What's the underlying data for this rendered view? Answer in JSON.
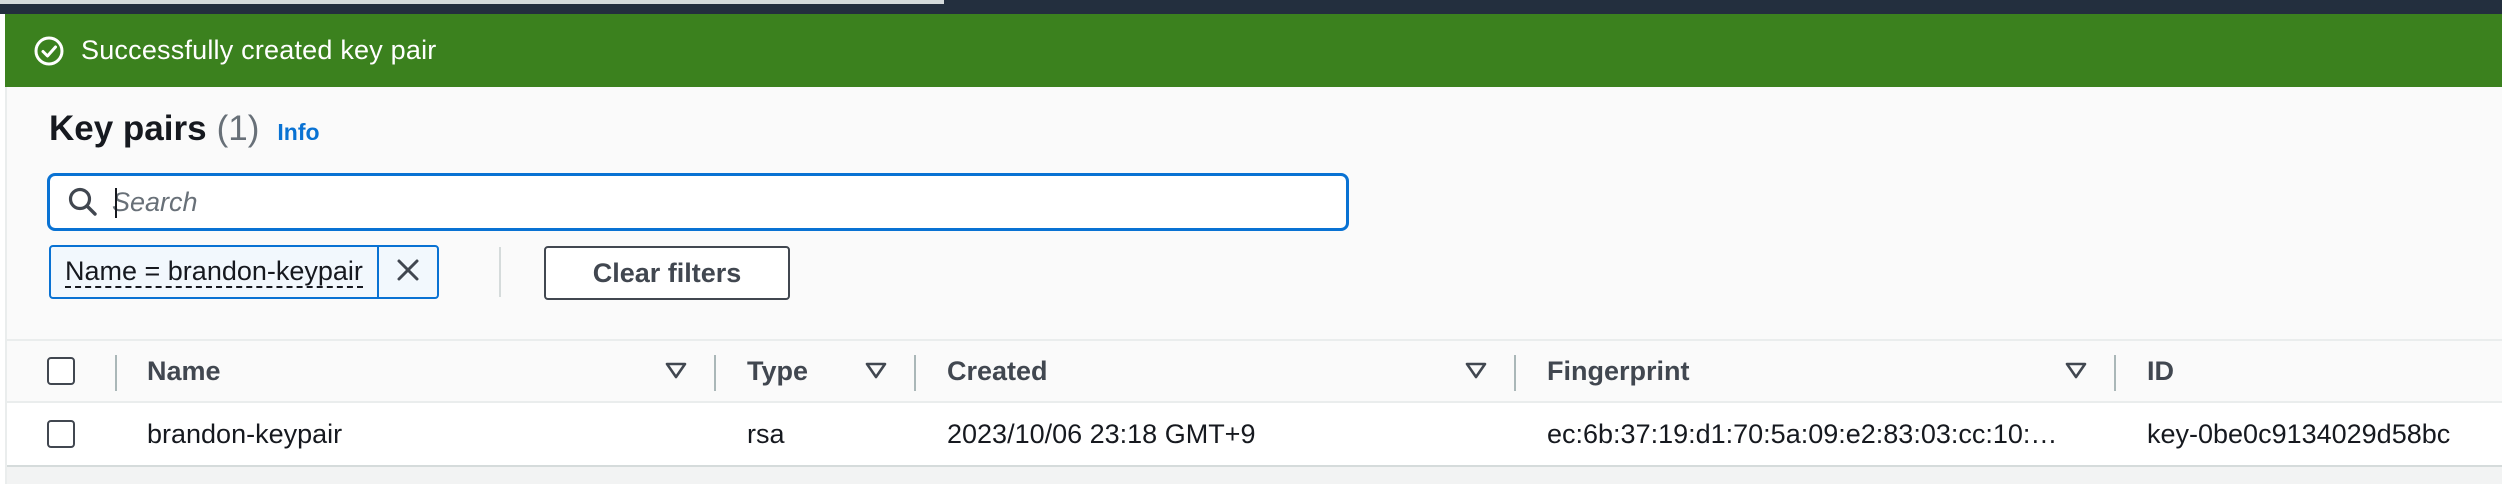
{
  "colors": {
    "success": "#3b811e",
    "link": "#0972d3",
    "text": "#16191f",
    "muted": "#687078"
  },
  "banner": {
    "icon": "check-circle-icon",
    "message": "Successfully created key pair"
  },
  "header": {
    "title": "Key pairs",
    "count": "(1)",
    "info_link": "Info"
  },
  "search": {
    "icon": "search-icon",
    "placeholder": "Search",
    "value": ""
  },
  "filter": {
    "token_label": "Name = brandon-keypair",
    "remove_icon": "close-icon",
    "clear_label": "Clear filters"
  },
  "table": {
    "columns": [
      "Name",
      "Type",
      "Created",
      "Fingerprint",
      "ID"
    ],
    "rows": [
      {
        "name": "brandon-keypair",
        "type": "rsa",
        "created": "2023/10/06 23:18 GMT+9",
        "fingerprint": "ec:6b:37:19:d1:70:5a:09:e2:83:03:cc:10:…",
        "id": "key-0be0c9134029d58bc"
      }
    ]
  }
}
